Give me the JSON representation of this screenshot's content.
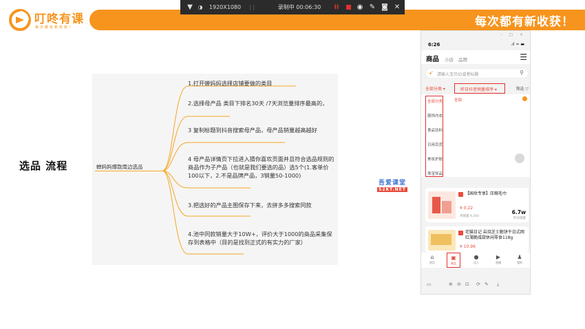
{
  "brand": {
    "logo_name": "叮咚有课",
    "logo_sub": "每次都有新收获！",
    "slogan": "每次都有新收获！",
    "accent_color": "#f7941d"
  },
  "recorder": {
    "resolution": "1920X1080",
    "timer": "录制中 00:06:30",
    "icons": [
      "pin-icon",
      "contrast-icon",
      "pause-icon",
      "stop-icon",
      "brush-icon",
      "pen-icon",
      "camera-icon",
      "close-icon"
    ],
    "record_color": "#e0312f"
  },
  "page": {
    "title": "选品 流程"
  },
  "mindmap": {
    "root": "蝉妈妈爆款周边选品",
    "branch_color": "#f5a623",
    "nodes": [
      "1.打开蝉妈妈选择店铺要做的类目",
      "2.选择母产品 类目下排名30天 /7天浏览量排序最高的，",
      "3 复制标题到抖音搜索母产品，母产品销量越高越好",
      "4  母产品详情页下拉进入猜你喜欢页面并且符合选品规则的商品作为子产品（也就是我们要选的品）选5个(1.客单价100以下，2.不是品牌产品，3销量50-1000)",
      "3.把选好的产品主图保存下来，去拼多多搜索同款",
      "4.池中同款销量大于10W+，评价大于1000的商品采集保存到表格中（目的是找到正式的有实力的厂家）"
    ]
  },
  "watermark": {
    "line1": "吾爱课堂",
    "line2": "52KT.NET"
  },
  "phone": {
    "window_controls": "- □ ×",
    "time": "6:26",
    "signal": ".ıl ≈ ▬",
    "title": "商品",
    "tabs": [
      "小店",
      "品牌"
    ],
    "search_placeholder": "请输入宝贝ID或者标题",
    "filter_category": "全部分类 ▾",
    "filter_sort": "昨日抖音销量排序 ▾",
    "filter_more": "筛选 ▽",
    "categories": [
      "全部分类",
      "服饰内衣",
      "食品饮料",
      "日用百货",
      "美妆护肤",
      "珠宝饰品"
    ],
    "selected_sub": "全部",
    "products": [
      {
        "title": "【国岳专享】压缩毛巾",
        "price": "¥ 0.22",
        "sales": "月销量 9,350",
        "stat": "6.7w",
        "stat_label": "昨日销量"
      },
      {
        "title": "宅猫日记 岩烧芝士脆饼干日式网红薄脆咸甜休闲零食118g",
        "price": "¥ 10.96",
        "sales": "",
        "stat": "",
        "stat_label": ""
      }
    ],
    "nav": [
      {
        "icon": "home-icon",
        "glyph": "⌂",
        "label": "首页"
      },
      {
        "icon": "shop-bag-icon",
        "glyph": "▣",
        "label": "商品"
      },
      {
        "icon": "people-icon",
        "glyph": "●",
        "label": "达人"
      },
      {
        "icon": "video-icon",
        "glyph": "▶",
        "label": "直播"
      },
      {
        "icon": "user-icon",
        "glyph": "♟",
        "label": "我的"
      }
    ],
    "bottom_tools": [
      "▭",
      "⊕",
      "⊖",
      "⊡",
      "⟳",
      "✎",
      "⤓"
    ]
  }
}
